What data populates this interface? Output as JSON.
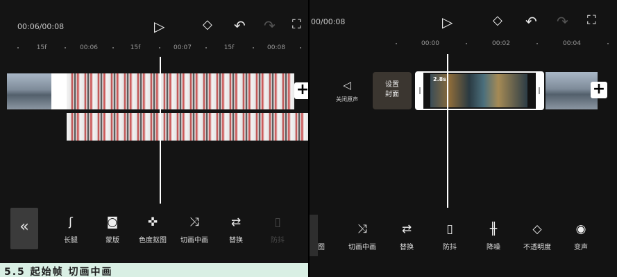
{
  "left": {
    "time_display": "00:06/00:08",
    "ruler": [
      "15f",
      "00:06",
      "15f",
      "00:07",
      "15f",
      "00:08"
    ],
    "toolbar": [
      {
        "icon": "legs-icon",
        "glyph": "ʃ",
        "label": "长腿"
      },
      {
        "icon": "mask-icon",
        "glyph": "◙",
        "label": "蒙版"
      },
      {
        "icon": "chroma-key-icon",
        "glyph": "✜",
        "label": "色度抠图"
      },
      {
        "icon": "shuffle-icon",
        "glyph": "⤨",
        "label": "切画中画"
      },
      {
        "icon": "replace-icon",
        "glyph": "⇄",
        "label": "替换"
      },
      {
        "icon": "stabilize-icon",
        "glyph": "▯",
        "label": "防抖"
      }
    ],
    "collapse_glyph": "«",
    "bottom_text": "5.5  起始帧 切画中画"
  },
  "right": {
    "time_display": "00/00:08",
    "ruler": [
      "00:00",
      "00:02",
      "00:04"
    ],
    "mute_label": "关闭原声",
    "cover_label_1": "设置",
    "cover_label_2": "封面",
    "clip_duration": "2.8s",
    "toolbar": [
      {
        "icon": "partial-icon",
        "glyph": "",
        "label": "图"
      },
      {
        "icon": "shuffle-icon",
        "glyph": "⤨",
        "label": "切画中画"
      },
      {
        "icon": "replace-icon",
        "glyph": "⇄",
        "label": "替换"
      },
      {
        "icon": "stabilize-icon",
        "glyph": "▯",
        "label": "防抖"
      },
      {
        "icon": "denoise-icon",
        "glyph": "╫",
        "label": "降噪"
      },
      {
        "icon": "opacity-icon",
        "glyph": "◇",
        "label": "不透明度"
      },
      {
        "icon": "voice-change-icon",
        "glyph": "◉",
        "label": "变声"
      }
    ]
  },
  "icons": {
    "play": "▷",
    "keyframe": "◇",
    "undo": "↶",
    "redo": "↷",
    "fullscreen": "⛶",
    "add": "+",
    "speaker": "◁"
  }
}
